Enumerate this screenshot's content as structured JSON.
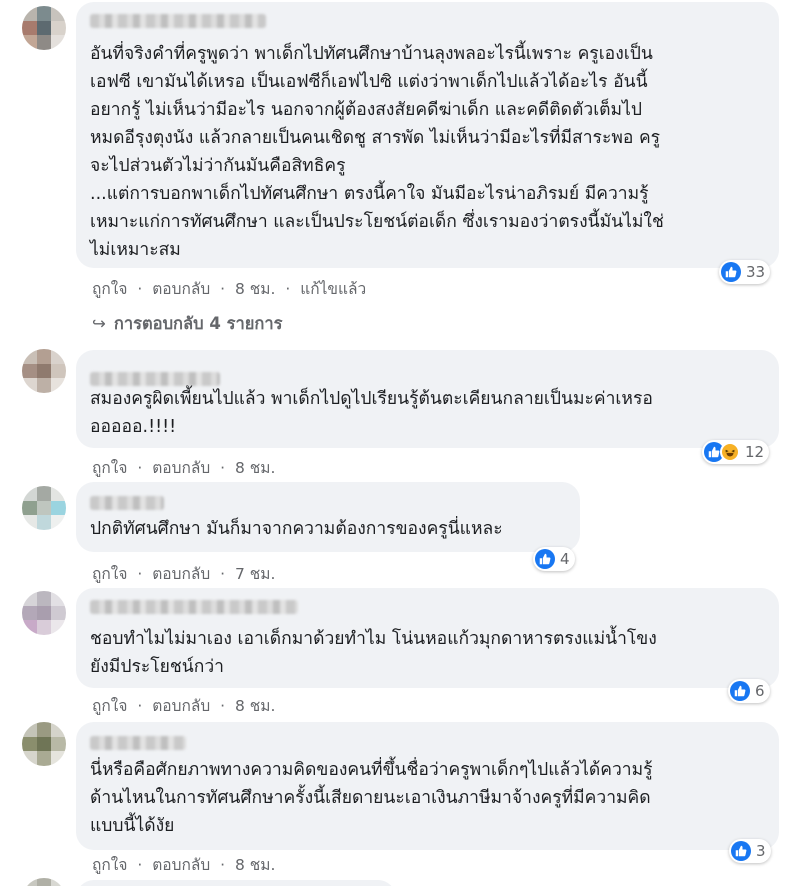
{
  "colors": {
    "bubble_bg": "#f0f2f5",
    "like_blue": "#1877f2",
    "haha_yellow": "#f7b125",
    "meta_gray": "#65676b"
  },
  "actions": {
    "like": "ถูกใจ",
    "reply": "ตอบกลับ",
    "separator": "·"
  },
  "comments": [
    {
      "body": "อันที่จริงคำที่ครูพูดว่า พาเด็กไปทัศนศึกษาบ้านลุงพลอะไรนี้เพราะ ครูเองเป็น\nเอฟซี เขามันได้เหรอ เป็นเอฟซีก็เอฟไปซิ แต่งว่าพาเด็กไปแล้วได้อะไร อันนี้\nอยากรู้ ไม่เห็นว่ามีอะไร นอกจากผู้ต้องสงสัยคดีฆ่าเด็ก และคดีติดตัวเต็มไป\nหมดอีรุงตุงนัง แล้วกลายเป็นคนเชิดชู สารพัด ไม่เห็นว่ามีอะไรที่มีสาระพอ ครู\nจะไปส่วนตัวไม่ว่ากันมันคือสิทธิครู\n...แต่การบอกพาเด็กไปทัศนศึกษา ตรงนี้คาใจ มันมีอะไรน่าอภิรมย์ มีความรู้\nเหมาะแก่การทัศนศึกษา และเป็นประโยชน์ต่อเด็ก ซึ่งเรามองว่าตรงนี้มันไม่ใช่\nไม่เหมาะสม",
      "time": "8 ชม.",
      "edited": "แก้ไขแล้ว",
      "reaction_count": "33",
      "replies_label": "การตอบกลับ 4 รายการ"
    },
    {
      "body": "สมองครูผิดเพี้ยนไปแล้ว พาเด็กไปดูไปเรียนรู้ต้นตะเคียนกลายเป็นมะค่าเหรอ\nอออออ.!!!!",
      "time": "8 ชม.",
      "reaction_count": "12"
    },
    {
      "body": "ปกติทัศนศึกษา มันก็มาจากความต้องการของครูนี่แหละ",
      "time": "7 ชม.",
      "reaction_count": "4"
    },
    {
      "body": "ชอบทำไมไม่มาเอง เอาเด็กมาด้วยทำไม โน่นหอแก้วมุกดาหารตรงแม่น้ำโขง\nยังมีประโยชน์กว่า",
      "time": "8 ชม.",
      "reaction_count": "6"
    },
    {
      "body": "นี่หรือคือศักยภาพทางความคิดของคนที่ขึ้นชื่อว่าครูพาเด็กๆไปแล้วได้ความรู้\nด้านไหนในการทัศนศึกษาครั้งนี้เสียดายนะเอาเงินภาษีมาจ้างครูที่มีความคิด\nแบบนี้ได้งัย",
      "time": "8 ชม.",
      "reaction_count": "3"
    }
  ]
}
